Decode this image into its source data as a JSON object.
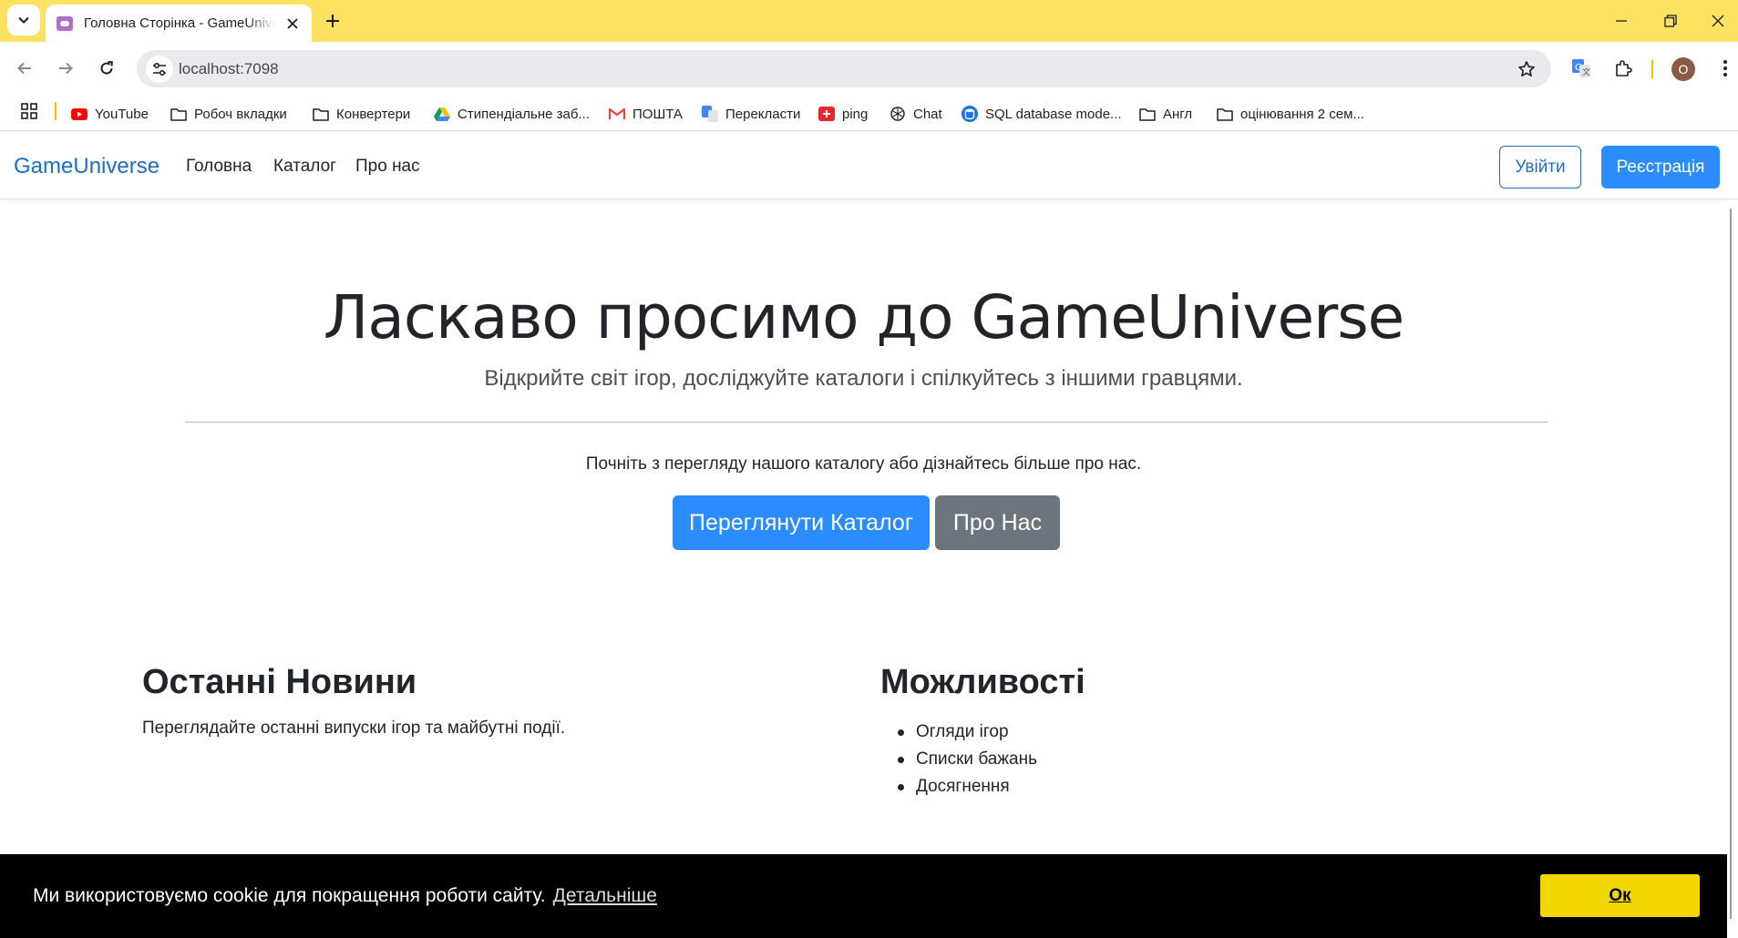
{
  "browser": {
    "tab_title": "Головна Сторінка - GameUniverse",
    "url": "localhost:7098",
    "profile_initial": "O",
    "accent": "#fde262"
  },
  "bookmarks": [
    {
      "label": "YouTube",
      "icon": "youtube-icon"
    },
    {
      "label": "Робоч вкладки",
      "icon": "folder-icon"
    },
    {
      "label": "Конвертери",
      "icon": "folder-icon"
    },
    {
      "label": "Стипендіальне заб...",
      "icon": "drive-icon"
    },
    {
      "label": "ПОШТА",
      "icon": "gmail-icon"
    },
    {
      "label": "Перекласти",
      "icon": "translate-icon"
    },
    {
      "label": "ping",
      "icon": "ping-icon"
    },
    {
      "label": "Chat",
      "icon": "chatgpt-icon"
    },
    {
      "label": "SQL database mode...",
      "icon": "database-icon"
    },
    {
      "label": "Англ",
      "icon": "folder-icon"
    },
    {
      "label": "оцінювання 2 сем...",
      "icon": "folder-icon"
    }
  ],
  "navbar": {
    "brand": "GameUniverse",
    "links": [
      "Головна",
      "Каталог",
      "Про нас"
    ],
    "login": "Увійти",
    "register": "Реєстрація"
  },
  "hero": {
    "title": "Ласкаво просимо до GameUniverse",
    "subtitle": "Відкрийте світ ігор, досліджуйте каталоги і спілкуйтесь з іншими гравцями.",
    "lead": "Почніть з перегляду нашого каталогу або дізнайтесь більше про нас.",
    "catalog_button": "Переглянути Каталог",
    "about_button": "Про Нас"
  },
  "news": {
    "title": "Останні Новини",
    "text": "Переглядайте останні випуски ігор та майбутні події."
  },
  "features": {
    "title": "Можливості",
    "items": [
      "Огляди ігор",
      "Списки бажань",
      "Досягнення"
    ]
  },
  "cookie": {
    "message": "Ми використовуємо cookie для покращення роботи сайту.",
    "more": "Детальніше",
    "ok": "Ок"
  }
}
